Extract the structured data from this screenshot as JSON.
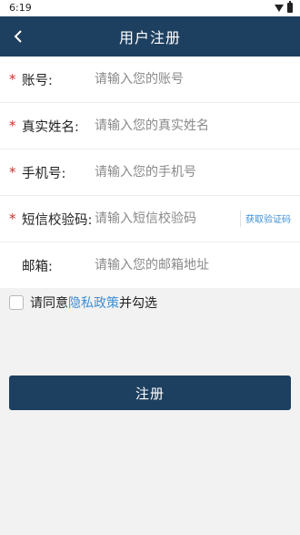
{
  "status_bar": {
    "time": "6:19"
  },
  "header": {
    "title": "用户注册",
    "back_icon": "chevron-left-icon"
  },
  "form": {
    "account": {
      "label": "账号:",
      "placeholder": "请输入您的账号",
      "required": true
    },
    "real_name": {
      "label": "真实姓名:",
      "placeholder": "请输入您的真实姓名",
      "required": true
    },
    "phone": {
      "label": "手机号:",
      "placeholder": "请输入您的手机号",
      "required": true
    },
    "sms_code": {
      "label": "短信校验码:",
      "placeholder": "请输入短信校验码",
      "required": true,
      "get_code_label": "获取验证码"
    },
    "email": {
      "label": "邮箱:",
      "placeholder": "请输入您的邮箱地址",
      "required": false
    }
  },
  "required_mark": "*",
  "agreement": {
    "prefix": "请同意",
    "link": "隐私政策",
    "suffix": "并勾选",
    "checked": false
  },
  "submit": {
    "label": "注册"
  },
  "colors": {
    "primary": "#1e4060",
    "link": "#3d8fd6",
    "required": "#c8352e",
    "background": "#f2f2f2"
  }
}
